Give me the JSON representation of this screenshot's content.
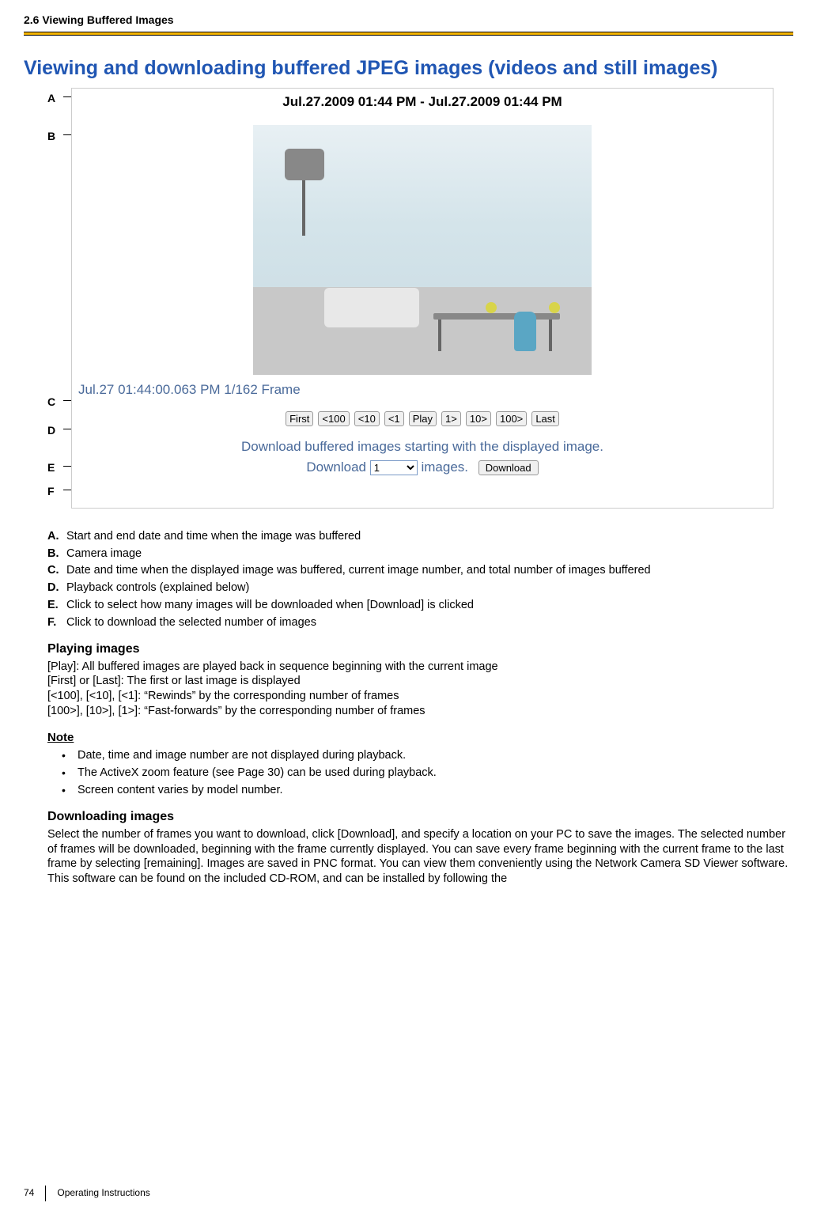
{
  "header": {
    "section": "2.6 Viewing Buffered Images"
  },
  "title": "Viewing and downloading buffered JPEG images (videos and still images)",
  "viewer": {
    "date_range": "Jul.27.2009 01:44 PM - Jul.27.2009 01:44 PM",
    "status": "Jul.27 01:44:00.063 PM   1/162 Frame",
    "buttons": {
      "first": "First",
      "b100": "<100",
      "b10": "<10",
      "b1": "<1",
      "play": "Play",
      "f1": "1>",
      "f10": "10>",
      "f100": "100>",
      "last": "Last"
    },
    "download_prompt": "Download buffered images starting with the displayed image.",
    "download_label": "Download",
    "download_count": "1",
    "download_suffix": "images.",
    "download_button": "Download"
  },
  "labels": {
    "A": "A",
    "B": "B",
    "C": "C",
    "D": "D",
    "E": "E",
    "F": "F"
  },
  "legend": {
    "A": "Start and end date and time when the image was buffered",
    "B": "Camera image",
    "C": "Date and time when the displayed image was buffered, current image number, and total number of images buffered",
    "D": "Playback controls (explained below)",
    "E": "Click to select how many images will be downloaded when [Download] is clicked",
    "F": "Click to download the selected number of images"
  },
  "playing": {
    "heading": "Playing images",
    "lines": [
      "[Play]: All buffered images are played back in sequence beginning with the current image",
      "[First] or [Last]: The first or last image is displayed",
      "[<100], [<10], [<1]: “Rewinds” by the corresponding number of frames",
      "[100>], [10>], [1>]: “Fast-forwards” by the corresponding number of frames"
    ]
  },
  "note": {
    "heading": "Note",
    "items": [
      "Date, time and image number are not displayed during playback.",
      "The ActiveX zoom feature (see Page 30) can be used during playback.",
      "Screen content varies by model number."
    ]
  },
  "downloading": {
    "heading": "Downloading images",
    "body": "Select the number of frames you want to download, click [Download], and specify a location on your PC to save the images. The selected number of frames will be downloaded, beginning with the frame currently displayed. You can save every frame beginning with the current frame to the last frame by selecting [remaining]. Images are saved in PNC format. You can view them conveniently using the Network Camera SD Viewer software. This software can be found on the included CD-ROM, and can be installed by following the"
  },
  "footer": {
    "page": "74",
    "title": "Operating Instructions"
  }
}
